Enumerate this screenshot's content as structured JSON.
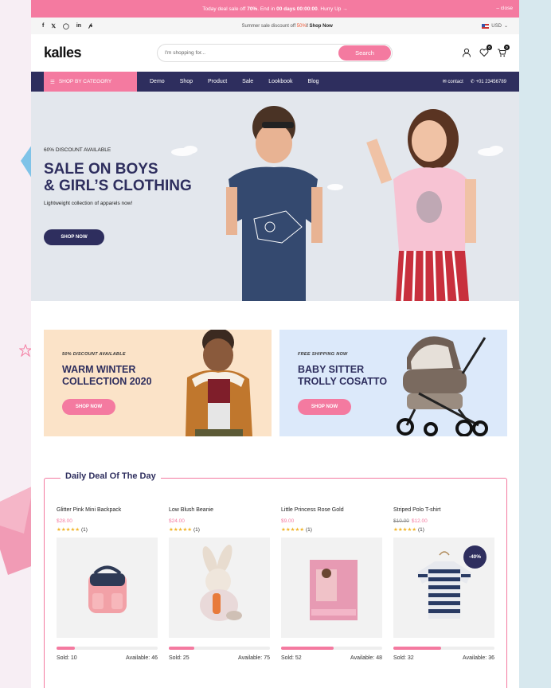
{
  "topbar": {
    "text_prefix": "Today deal sale off ",
    "percent": "70%",
    "text_mid": ". End in ",
    "timer": "00 days 00:00:00",
    "text_suffix": ". Hurry Up →",
    "close": "– close"
  },
  "infobar": {
    "social_icons": [
      "facebook-icon",
      "twitter-icon",
      "instagram-icon",
      "linkedin-icon",
      "pinterest-icon"
    ],
    "promo_prefix": "Summer sale discount off ",
    "promo_highlight": "50%",
    "promo_link": "! Shop Now",
    "currency": "USD"
  },
  "header": {
    "logo": "kalles",
    "search_placeholder": "I'm shopping for...",
    "search_button": "Search",
    "wishlist_count": "0",
    "cart_count": "0"
  },
  "nav": {
    "category": "SHOP BY CATEGORY",
    "items": [
      "Demo",
      "Shop",
      "Product",
      "Sale",
      "Lookbook",
      "Blog"
    ],
    "contact": "contact",
    "phone": "+01 23456789"
  },
  "hero": {
    "sub": "60% DISCOUNT AVAILABLE",
    "title_line1": "SALE ON BOYS",
    "title_line2": "& GIRL’S CLOTHING",
    "desc": "Lightweight collection of apparels now!",
    "button": "SHOP NOW"
  },
  "banners": [
    {
      "sub": "50% DISCOUNT AVAILABLE",
      "title_line1": "WARM WINTER",
      "title_line2": "COLLECTION 2020",
      "button": "SHOP NOW"
    },
    {
      "sub": "FREE SHIPPING NOW",
      "title_line1": "BABY SITTER",
      "title_line2": "TROLLY COSATTO",
      "button": "SHOP NOW"
    }
  ],
  "deal": {
    "title": "Daily Deal Of The Day",
    "products": [
      {
        "name": "Glitter Pink Mini Backpack",
        "old_price": "",
        "price": "$28.00",
        "rating_count": "(1)",
        "badge": "",
        "sold": "Sold: 10",
        "available": "Available: 46",
        "progress": 0.18
      },
      {
        "name": "Low Blush Beanie",
        "old_price": "",
        "price": "$24.00",
        "rating_count": "(1)",
        "badge": "",
        "sold": "Sold: 25",
        "available": "Available: 75",
        "progress": 0.25
      },
      {
        "name": "Little Princess Rose Gold",
        "old_price": "",
        "price": "$9.00",
        "rating_count": "(1)",
        "badge": "",
        "sold": "Sold: 52",
        "available": "Available: 48",
        "progress": 0.52
      },
      {
        "name": "Striped Polo T-shirt",
        "old_price": "$10.00",
        "price": "$12.00",
        "rating_count": "(1)",
        "badge": "-40%",
        "sold": "Sold: 32",
        "available": "Available: 36",
        "progress": 0.47
      }
    ]
  },
  "colors": {
    "accent": "#f47aa0",
    "navy": "#2e2e5e"
  }
}
